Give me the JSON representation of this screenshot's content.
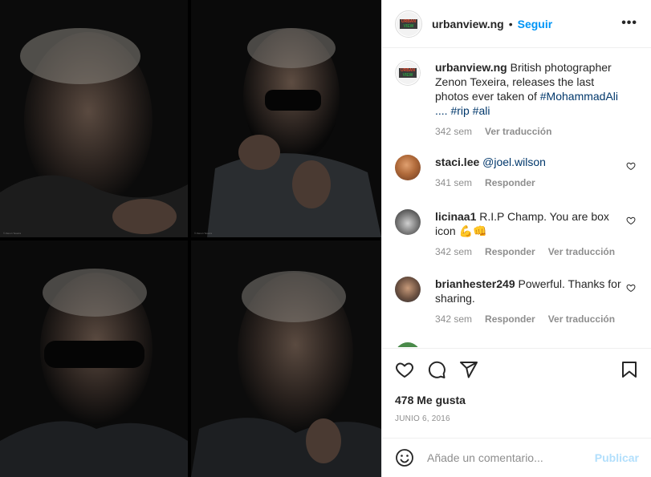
{
  "post": {
    "username": "urbanview.ng",
    "follow_label": "Seguir",
    "more_label": "•••",
    "caption": "British photographer Zenon Texeira, releases the last photos ever taken of ",
    "caption_tags": "#MohammadAli .... #rip #ali",
    "caption_time": "342 sem",
    "caption_translate": "Ver traducción",
    "likes": "478 Me gusta",
    "date": "JUNIO 6, 2016",
    "photo_credits": [
      "© Zenon Texeira",
      "© Zenon Texeira"
    ]
  },
  "comments": [
    {
      "user": "staci.lee",
      "mention": "@joel.wilson",
      "text": "",
      "time": "341 sem",
      "reply": "Responder",
      "translate": ""
    },
    {
      "user": "licinaa1",
      "mention": "",
      "text": "R.I.P Champ. You are box icon 💪👊",
      "time": "342 sem",
      "reply": "Responder",
      "translate": "Ver traducción"
    },
    {
      "user": "brianhester249",
      "mention": "",
      "text": "Powerful. Thanks for sharing.",
      "time": "342 sem",
      "reply": "Responder",
      "translate": "Ver traducción"
    }
  ],
  "add_comment": {
    "placeholder": "Añade un comentario...",
    "publish_label": "Publicar"
  },
  "icons": [
    "heart-icon",
    "comment-icon",
    "share-icon",
    "bookmark-icon",
    "emoji-icon",
    "more-icon"
  ],
  "colors": {
    "accent": "#0095f6",
    "publish_disabled": "#b2dffc",
    "muted": "#8e8e8e",
    "link": "#00376b"
  }
}
